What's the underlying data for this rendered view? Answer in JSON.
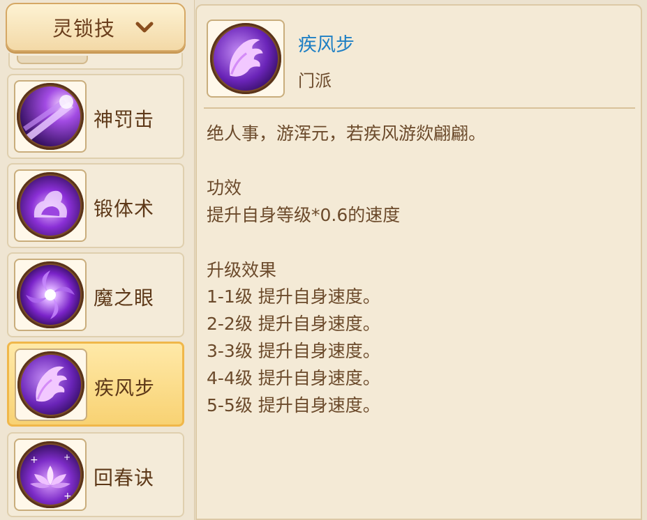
{
  "dropdown": {
    "label": "灵锁技",
    "icon": "chevron-down-icon"
  },
  "skills": [
    {
      "name": "神罚击",
      "icon": "divine-strike-icon",
      "selected": false
    },
    {
      "name": "锻体术",
      "icon": "body-forging-icon",
      "selected": false
    },
    {
      "name": "魔之眼",
      "icon": "demon-eye-icon",
      "selected": false
    },
    {
      "name": "疾风步",
      "icon": "wing-icon",
      "selected": true
    },
    {
      "name": "回春诀",
      "icon": "lotus-heal-icon",
      "selected": false
    }
  ],
  "detail": {
    "name": "疾风步",
    "type": "门派",
    "icon": "wing-icon",
    "flavor": "绝人事，游浑元，若疾风游欻翩翩。",
    "effect_title": "功效",
    "effect_text": "提升自身等级*0.6的速度",
    "upgrade_title": "升级效果",
    "upgrades": [
      "1-1级 提升自身速度。",
      "2-2级 提升自身速度。",
      "3-3级 提升自身速度。",
      "4-4级 提升自身速度。",
      "5-5级 提升自身速度。"
    ]
  },
  "colors": {
    "accent": "#1e7fc4",
    "selected_bg": "#f8d273",
    "text": "#6b4a2b"
  }
}
